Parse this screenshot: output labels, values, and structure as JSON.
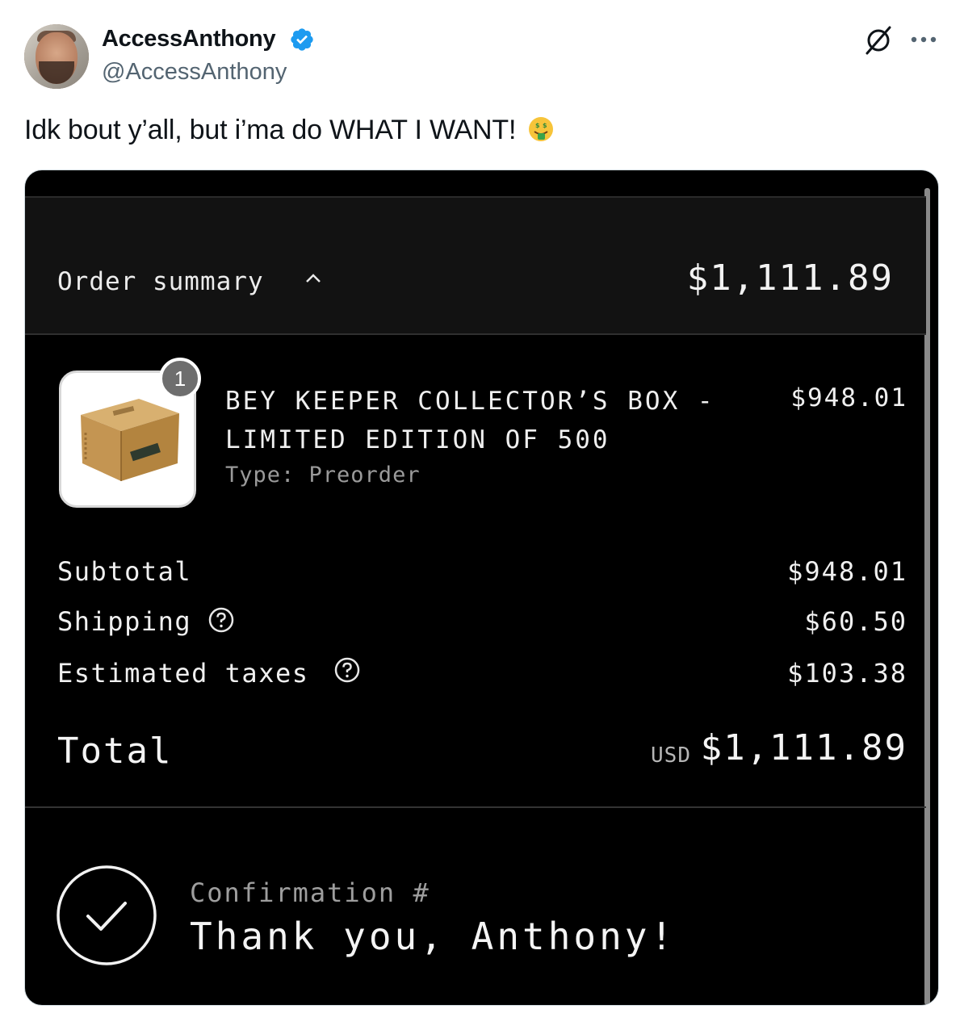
{
  "author": {
    "display_name": "AccessAnthony",
    "handle": "@AccessAnthony",
    "verified": true
  },
  "tweet": {
    "text": "Idk bout y’all, but i’ma do WHAT I WANT!",
    "emoji": "money-mouth-face"
  },
  "order": {
    "summary_label": "Order summary",
    "summary_total": "$1,111.89",
    "item": {
      "quantity": "1",
      "title": "BEY KEEPER COLLECTOR’S BOX - LIMITED EDITION OF 500",
      "type": "Type: Preorder",
      "price": "$948.01"
    },
    "subtotal_label": "Subtotal",
    "subtotal_value": "$948.01",
    "shipping_label": "Shipping",
    "shipping_value": "$60.50",
    "taxes_label": "Estimated taxes",
    "taxes_value": "$103.38",
    "total_label": "Total",
    "total_currency": "USD",
    "total_value": "$1,111.89",
    "confirmation_label": "Confirmation #",
    "thank_you": "Thank you, Anthony!"
  },
  "colors": {
    "verified_blue": "#1d9bf0",
    "handle_gray": "#536471",
    "card_bg": "#000000",
    "summary_bar_bg": "#121212"
  }
}
